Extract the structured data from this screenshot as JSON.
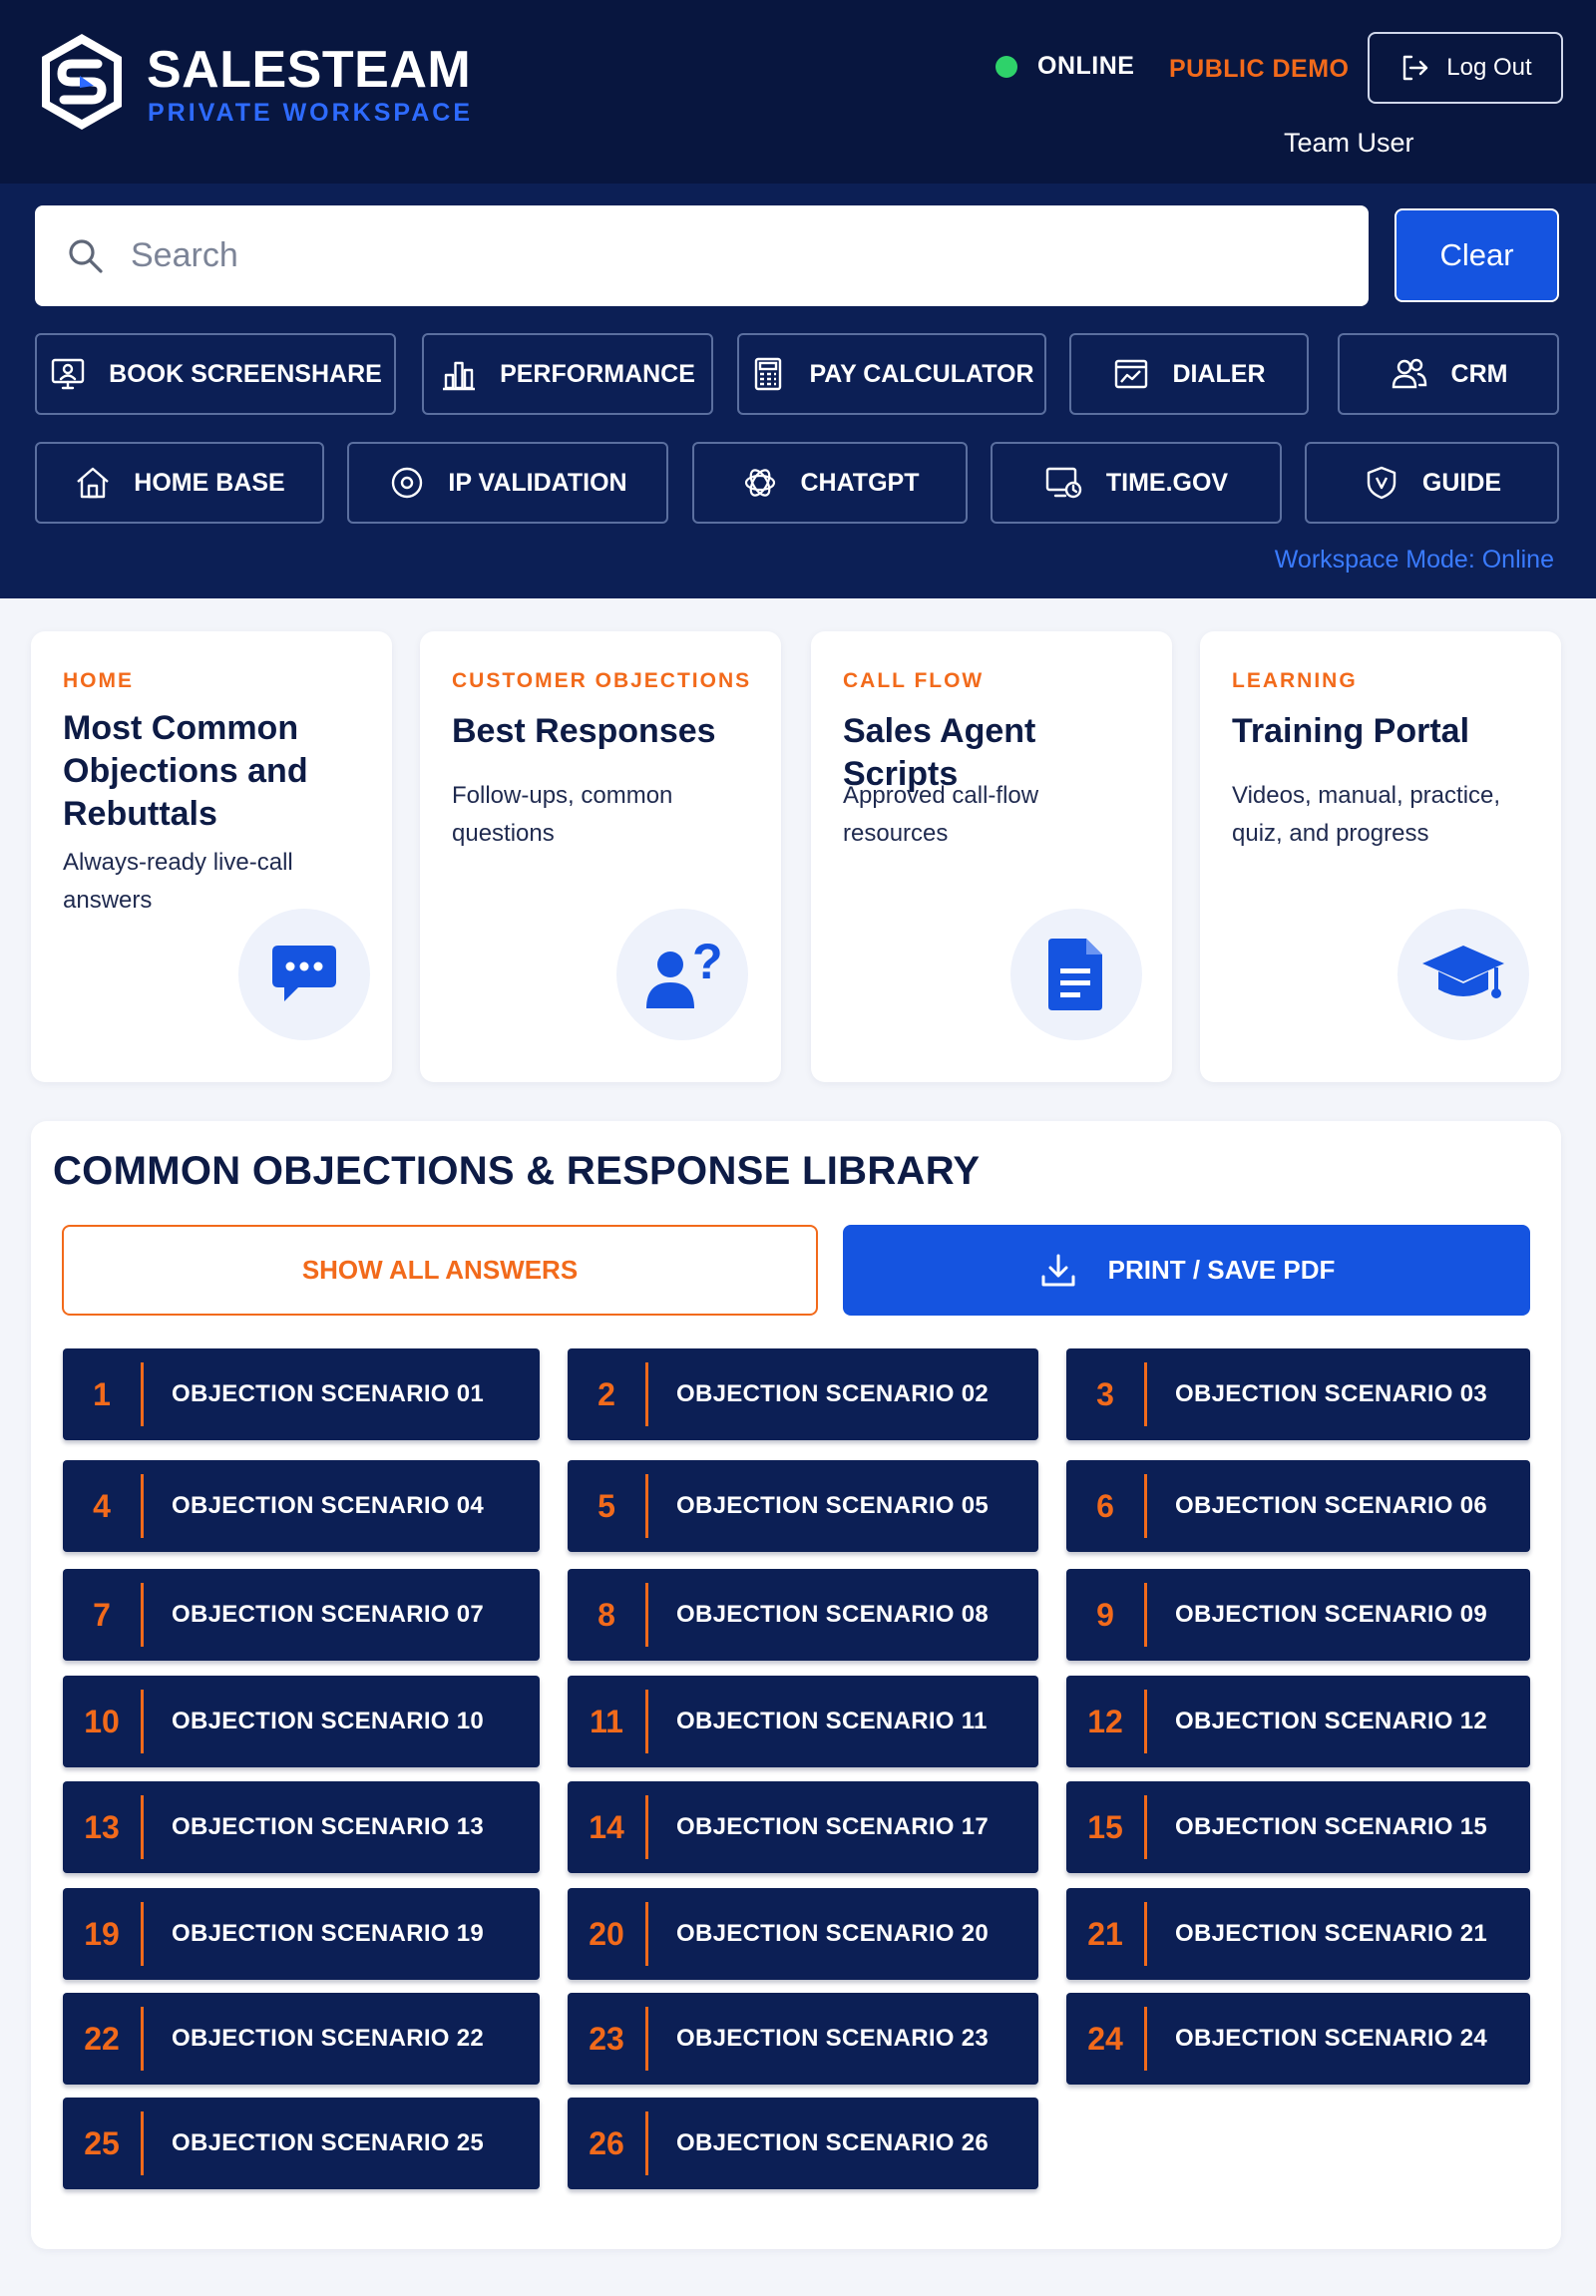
{
  "brand": {
    "name": "SALESTEAM",
    "subtitle": "PRIVATE WORKSPACE"
  },
  "status": {
    "online": "ONLINE",
    "demo": "PUBLIC DEMO",
    "user": "Team User",
    "logout": "Log Out"
  },
  "search": {
    "placeholder": "Search",
    "value": "",
    "clear": "Clear"
  },
  "nav": [
    {
      "label": "BOOK SCREENSHARE",
      "icon": "screenshare-icon"
    },
    {
      "label": "PERFORMANCE",
      "icon": "bar-chart-icon"
    },
    {
      "label": "PAY CALCULATOR",
      "icon": "calculator-icon"
    },
    {
      "label": "DIALER",
      "icon": "dialer-icon"
    },
    {
      "label": "CRM",
      "icon": "users-icon"
    },
    {
      "label": "HOME BASE",
      "icon": "home-icon"
    },
    {
      "label": "IP VALIDATION",
      "icon": "location-pin-icon"
    },
    {
      "label": "CHATGPT",
      "icon": "chatgpt-icon"
    },
    {
      "label": "TIME.GOV",
      "icon": "clock-monitor-icon"
    },
    {
      "label": "GUIDE",
      "icon": "shield-icon"
    }
  ],
  "mode": "Workspace Mode: Online",
  "cards": [
    {
      "kicker": "HOME",
      "title": "Most Common Objections and Rebuttals",
      "desc": "Always-ready live-call answers",
      "icon": "chat-bubble-icon"
    },
    {
      "kicker": "CUSTOMER OBJECTIONS",
      "title": "Best Responses",
      "desc": "Follow-ups, common questions",
      "icon": "user-question-icon"
    },
    {
      "kicker": "CALL FLOW",
      "title": "Sales Agent Scripts",
      "desc": "Approved call-flow resources",
      "icon": "document-icon"
    },
    {
      "kicker": "LEARNING",
      "title": "Training Portal",
      "desc": "Videos, manual, practice, quiz, and progress",
      "icon": "graduation-cap-icon"
    }
  ],
  "library": {
    "title": "COMMON OBJECTIONS & RESPONSE LIBRARY",
    "show_all": "SHOW ALL ANSWERS",
    "print": "PRINT / SAVE PDF",
    "scenarios": [
      {
        "num": "1",
        "label": "OBJECTION SCENARIO 01"
      },
      {
        "num": "2",
        "label": "OBJECTION SCENARIO 02"
      },
      {
        "num": "3",
        "label": "OBJECTION SCENARIO 03"
      },
      {
        "num": "4",
        "label": "OBJECTION SCENARIO 04"
      },
      {
        "num": "5",
        "label": "OBJECTION SCENARIO 05"
      },
      {
        "num": "6",
        "label": "OBJECTION SCENARIO 06"
      },
      {
        "num": "7",
        "label": "OBJECTION SCENARIO 07"
      },
      {
        "num": "8",
        "label": "OBJECTION SCENARIO 08"
      },
      {
        "num": "9",
        "label": "OBJECTION SCENARIO 09"
      },
      {
        "num": "10",
        "label": "OBJECTION SCENARIO 10"
      },
      {
        "num": "11",
        "label": "OBJECTION SCENARIO 11"
      },
      {
        "num": "12",
        "label": "OBJECTION SCENARIO 12"
      },
      {
        "num": "13",
        "label": "OBJECTION SCENARIO 13"
      },
      {
        "num": "14",
        "label": "OBJECTION SCENARIO 17"
      },
      {
        "num": "15",
        "label": "OBJECTION SCENARIO 15"
      },
      {
        "num": "19",
        "label": "OBJECTION SCENARIO 19"
      },
      {
        "num": "20",
        "label": "OBJECTION SCENARIO 20"
      },
      {
        "num": "21",
        "label": "OBJECTION SCENARIO 21"
      },
      {
        "num": "22",
        "label": "OBJECTION SCENARIO 22"
      },
      {
        "num": "23",
        "label": "OBJECTION SCENARIO 23"
      },
      {
        "num": "24",
        "label": "OBJECTION SCENARIO 24"
      },
      {
        "num": "25",
        "label": "OBJECTION SCENARIO 25"
      },
      {
        "num": "26",
        "label": "OBJECTION SCENARIO 26"
      }
    ]
  },
  "colors": {
    "navy": "#0c1f55",
    "topbar": "#08163f",
    "accent_orange": "#f26a1b",
    "accent_blue": "#1554e0",
    "online_green": "#2ed26a"
  }
}
